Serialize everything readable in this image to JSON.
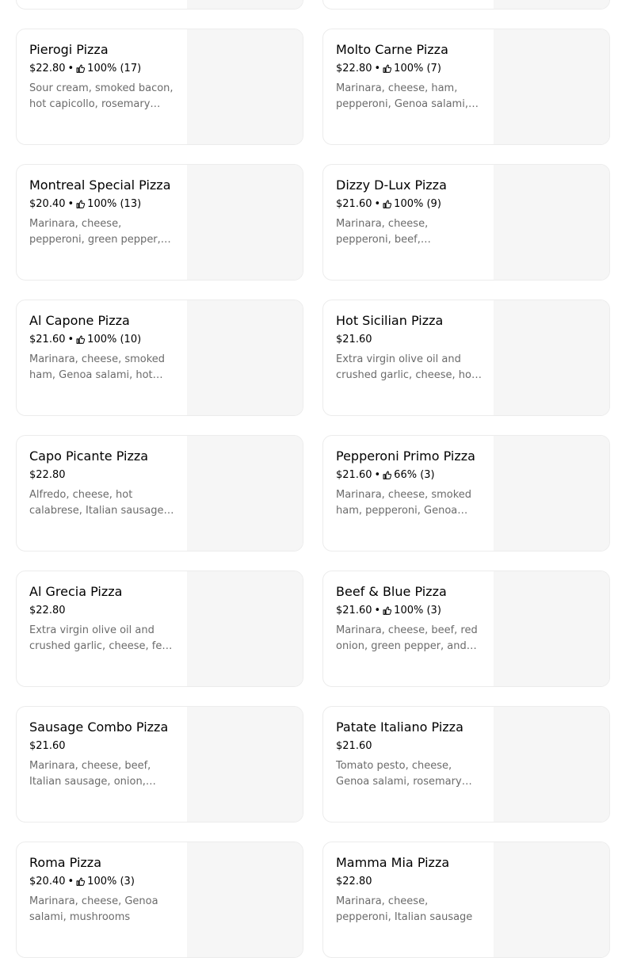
{
  "menu_items": [
    {
      "title": "",
      "price": "",
      "rating": "",
      "description": ""
    },
    {
      "title": "",
      "price": "",
      "rating": "",
      "description": ""
    },
    {
      "title": "Pierogi Pizza",
      "price": "$22.80",
      "rating": "100% (17)",
      "description": "Sour cream, smoked bacon, hot capicollo, rosemary potatoes"
    },
    {
      "title": "Molto Carne Pizza",
      "price": "$22.80",
      "rating": "100% (7)",
      "description": "Marinara, cheese, ham, pepperoni, Genoa salami, beef"
    },
    {
      "title": "Montreal Special Pizza",
      "price": "$20.40",
      "rating": "100% (13)",
      "description": "Marinara, cheese, pepperoni, green pepper, mushrooms"
    },
    {
      "title": "Dizzy D-Lux Pizza",
      "price": "$21.60",
      "rating": "100% (9)",
      "description": "Marinara, cheese, pepperoni, beef, mushrooms, onion"
    },
    {
      "title": "Al Capone Pizza",
      "price": "$21.60",
      "rating": "100% (10)",
      "description": "Marinara, cheese, smoked ham, Genoa salami, hot capicollo"
    },
    {
      "title": "Hot Sicilian Pizza",
      "price": "$21.60",
      "rating": "",
      "description": "Extra virgin olive oil and crushed garlic, cheese, hot calabrese"
    },
    {
      "title": "Capo Picante Pizza",
      "price": "$22.80",
      "rating": "",
      "description": "Alfredo, cheese, hot calabrese, Italian sausage, jalapeños"
    },
    {
      "title": "Pepperoni Primo Pizza",
      "price": "$21.60",
      "rating": "66% (3)",
      "description": "Marinara, cheese, smoked ham, pepperoni, Genoa salami"
    },
    {
      "title": "Al Grecia Pizza",
      "price": "$22.80",
      "rating": "",
      "description": "Extra virgin olive oil and crushed garlic, cheese, feta cheese"
    },
    {
      "title": "Beef & Blue Pizza",
      "price": "$21.60",
      "rating": "100% (3)",
      "description": "Marinara, cheese, beef, red onion, green pepper, and blue cheese"
    },
    {
      "title": "Sausage Combo Pizza",
      "price": "$21.60",
      "rating": "",
      "description": "Marinara, cheese, beef, Italian sausage, onion, mushrooms"
    },
    {
      "title": "Patate Italiano Pizza",
      "price": "$21.60",
      "rating": "",
      "description": "Tomato pesto, cheese, Genoa salami, rosemary potatoes"
    },
    {
      "title": "Roma Pizza",
      "price": "$20.40",
      "rating": "100% (3)",
      "description": "Marinara, cheese, Genoa salami, mushrooms"
    },
    {
      "title": "Mamma Mia Pizza",
      "price": "$22.80",
      "rating": "",
      "description": "Marinara, cheese, pepperoni, Italian sausage"
    }
  ],
  "colors": {
    "card_border": "#ececec",
    "image_placeholder": "#f6f6f6",
    "description_text": "#6b6b6b"
  },
  "icons": {
    "rating": "thumbs-up-icon"
  }
}
